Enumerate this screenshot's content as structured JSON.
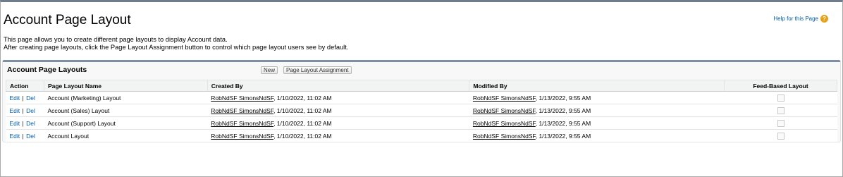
{
  "page": {
    "title": "Account Page Layout",
    "help_link": "Help for this Page",
    "description": [
      "This page allows you to create different page layouts to display Account data.",
      "After creating page layouts, click the Page Layout Assignment button to control which page layout users see by default."
    ]
  },
  "panel": {
    "title": "Account Page Layouts",
    "buttons": {
      "new": "New",
      "assignment": "Page Layout Assignment"
    }
  },
  "table": {
    "headers": [
      "Action",
      "Page Layout Name",
      "Created By",
      "Modified By",
      "Feed-Based Layout"
    ],
    "rows": [
      {
        "edit": "Edit",
        "sep": "|",
        "del": "Del",
        "name": "Account (Marketing) Layout",
        "created_user": "RobNdSF SimonsNdSF",
        "created_date": ", 1/10/2022, 11:02 AM",
        "modified_user": "RobNdSF SimonsNdSF",
        "modified_date": ", 1/13/2022, 9:55 AM"
      },
      {
        "edit": "Edit",
        "sep": "|",
        "del": "Del",
        "name": "Account (Sales) Layout",
        "created_user": "RobNdSF SimonsNdSF",
        "created_date": ", 1/10/2022, 11:02 AM",
        "modified_user": "RobNdSF SimonsNdSF",
        "modified_date": ", 1/13/2022, 9:55 AM"
      },
      {
        "edit": "Edit",
        "sep": "|",
        "del": "Del",
        "name": "Account (Support) Layout",
        "created_user": "RobNdSF SimonsNdSF",
        "created_date": ", 1/10/2022, 11:02 AM",
        "modified_user": "RobNdSF SimonsNdSF",
        "modified_date": ", 1/13/2022, 9:55 AM"
      },
      {
        "edit": "Edit",
        "sep": "|",
        "del": "Del",
        "name": "Account Layout",
        "created_user": "RobNdSF SimonsNdSF",
        "created_date": ", 1/10/2022, 11:02 AM",
        "modified_user": "RobNdSF SimonsNdSF",
        "modified_date": ", 1/13/2022, 9:55 AM"
      }
    ]
  },
  "icons": {
    "help": "question-circle-icon",
    "checkbox": "checkbox-unchecked-icon"
  },
  "colors": {
    "link": "#015ba7",
    "help_icon": "#e8a014",
    "panel_accent": "#7f8ea3"
  }
}
